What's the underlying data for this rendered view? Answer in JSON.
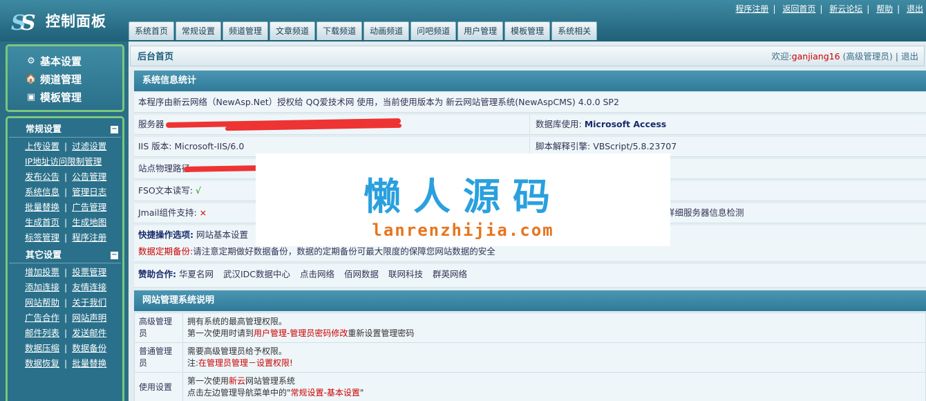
{
  "header": {
    "title": "控制面板",
    "top_links": [
      "程序注册",
      "返回首页",
      "新云论坛",
      "帮助",
      "退出"
    ],
    "tabs": [
      "系统首页",
      "常规设置",
      "频道管理",
      "文章频道",
      "下载频道",
      "动画频道",
      "问吧频道",
      "用户管理",
      "模板管理",
      "系统相关"
    ]
  },
  "sidebar": {
    "quick": [
      {
        "label": "基本设置",
        "icon": "gear-icon"
      },
      {
        "label": "频道管理",
        "icon": "house-icon"
      },
      {
        "label": "模板管理",
        "icon": "template-icon"
      }
    ],
    "groups": [
      {
        "title": "常规设置",
        "toggle": "−",
        "rows": [
          [
            "上传设置",
            "过滤设置"
          ],
          [
            "IP地址访问限制管理"
          ],
          [
            "发布公告",
            "公告管理"
          ],
          [
            "系统信息",
            "管理日志"
          ],
          [
            "批量替换",
            "广告管理"
          ],
          [
            "生成首页",
            "生成地图"
          ],
          [
            "标签管理",
            "程序注册"
          ]
        ]
      },
      {
        "title": "其它设置",
        "toggle": "−",
        "rows": [
          [
            "增加投票",
            "投票管理"
          ],
          [
            "添加连接",
            "友情连接"
          ],
          [
            "网站帮助",
            "关于我们"
          ],
          [
            "广告合作",
            "网站声明"
          ],
          [
            "邮件列表",
            "发送邮件"
          ],
          [
            "数据压缩",
            "数据备份"
          ],
          [
            "数据恢复",
            "批量替换"
          ]
        ]
      }
    ]
  },
  "main": {
    "crumb": "后台首页",
    "welcome_prefix": "欢迎:",
    "welcome_user": "ganjiang16",
    "welcome_role": "(高级管理员)",
    "logout": "退出",
    "stats_title": "系统信息统计",
    "intro": "本程序由新云网络（NewAsp.Net）授权给 QQ爱技术网 使用，当前使用版本为 新云网站管理系统(NewAspCMS) 4.0.0 SP2",
    "server_label": "服务器",
    "db_label": "数据库使用:",
    "db_value": "Microsoft Access",
    "iis_label": "IIS 版本:",
    "iis_value": "Microsoft-IIS/6.0",
    "script_label": "脚本解释引擎:",
    "script_value": "VBScript/5.8.23707",
    "path_label": "站点物理路径",
    "fso_label": "FSO文本读写:",
    "fso_value": "√",
    "jmail_label": "Jmail组件支持:",
    "jmail_value": "×",
    "detail_check": "详细服务器信息检测",
    "quick_label": "快捷操作选项:",
    "quick_links": [
      "网站基本设置"
    ],
    "backup_label": "数据定期备份:",
    "backup_text": "请注意定期做好数据备份，数据的定期备份可最大限度的保障您网站数据的安全",
    "sponsor_label": "赞助合作:",
    "sponsors": [
      "华夏名网",
      "武汉IDC数据中心",
      "点击网络",
      "佰网数据",
      "联网科技",
      "群英网络"
    ],
    "help_title": "网站管理系统说明",
    "roles": [
      {
        "label": "高级管理员",
        "line1": "拥有系统的最高管理权限。",
        "line2_pre": "第一次使用时请到",
        "line2_link": "用户管理-管理员密码修改",
        "line2_post": "重新设置管理密码"
      },
      {
        "label": "普通管理员",
        "line1": "需要高级管理员给予权限。",
        "line2_pre": "注:",
        "line2_link": "在管理员管理－设置权限!",
        "line2_post": ""
      },
      {
        "label": "使用设置",
        "line1_pre": "第一次使用",
        "line1_link": "新云",
        "line1_post": "网站管理系统",
        "line2_pre": "点击左边管理导航菜单中的\"",
        "line2_link": "常规设置-基本设置",
        "line2_post": "\""
      }
    ]
  },
  "watermark": {
    "big": "懒人源码",
    "small": "lanrenzhijia.com"
  }
}
